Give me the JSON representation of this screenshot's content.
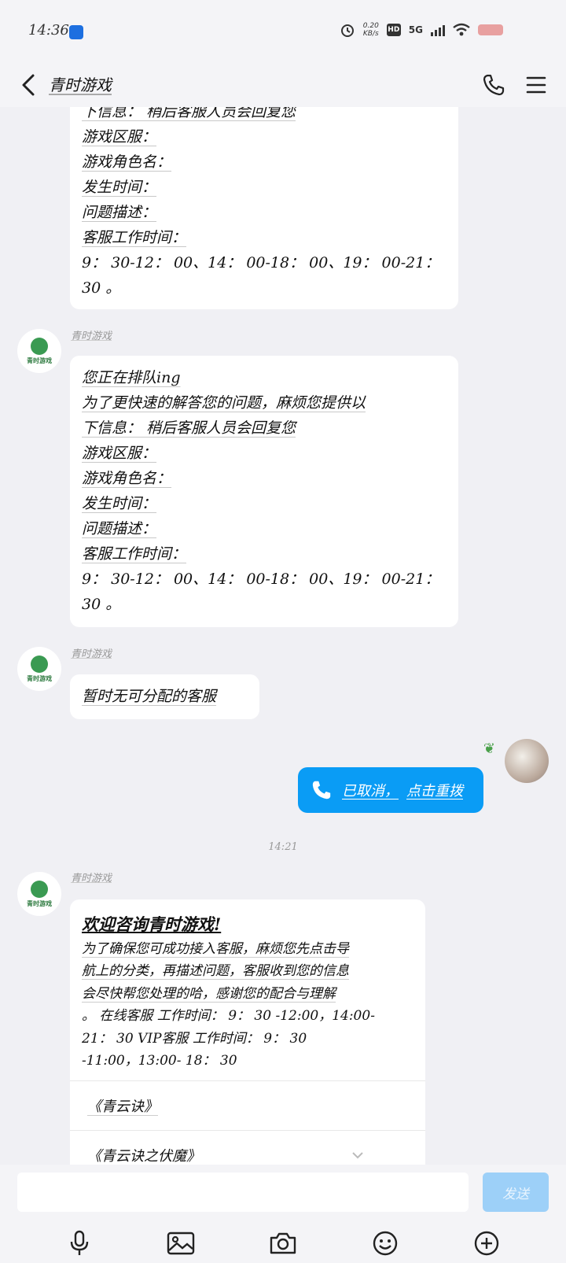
{
  "status_bar": {
    "time": "14:36",
    "net_speed_value": "0.20",
    "net_speed_unit": "KB/s",
    "hd_label": "HD",
    "network_label": "5G"
  },
  "header": {
    "title": "青时游戏"
  },
  "messages": {
    "msg1": {
      "lines": [
        "下信息： 稍后客服人员会回复您",
        "游戏区服：",
        "游戏角色名：",
        "发生时间：",
        "问题描述：",
        "客服工作时间：",
        "9： 30-12： 00、14： 00-18： 00、19： 00-21：",
        "30 。"
      ]
    },
    "msg2": {
      "sender": "青时游戏",
      "lines": [
        "您正在排队ing",
        "为了更快速的解答您的问题，麻烦您提供以",
        "下信息： 稍后客服人员会回复您",
        "游戏区服：",
        "游戏角色名：",
        "发生时间：",
        "问题描述：",
        "客服工作时间：",
        "9： 30-12： 00、14： 00-18： 00、19： 00-21：",
        "30 。"
      ]
    },
    "msg3": {
      "sender": "青时游戏",
      "text": "暂时无可分配的客服"
    },
    "msg4": {
      "status": "已取消，",
      "action": "点击重拨"
    },
    "timestamp": "14:21",
    "msg5": {
      "sender": "青时游戏",
      "title": "欢迎咨询青时游戏!",
      "lines": [
        "为了确保您可成功接入客服，麻烦您先点击导",
        "航上的分类，再描述问题，客服收到您的信息",
        "会尽快帮您处理的哈，感谢您的配合与理解",
        "。 在线客服 工作时间： 9： 30 -12:00，14:00-",
        "21： 30 VIP客服 工作时间： 9： 30",
        "-11:00，13:00- 18： 30"
      ],
      "menu_items": [
        "《青云诀》",
        "《青云诀之伏魔》"
      ]
    },
    "avatar_brand": "青时游戏"
  },
  "input_bar": {
    "placeholder": "",
    "send_label": "发送"
  }
}
